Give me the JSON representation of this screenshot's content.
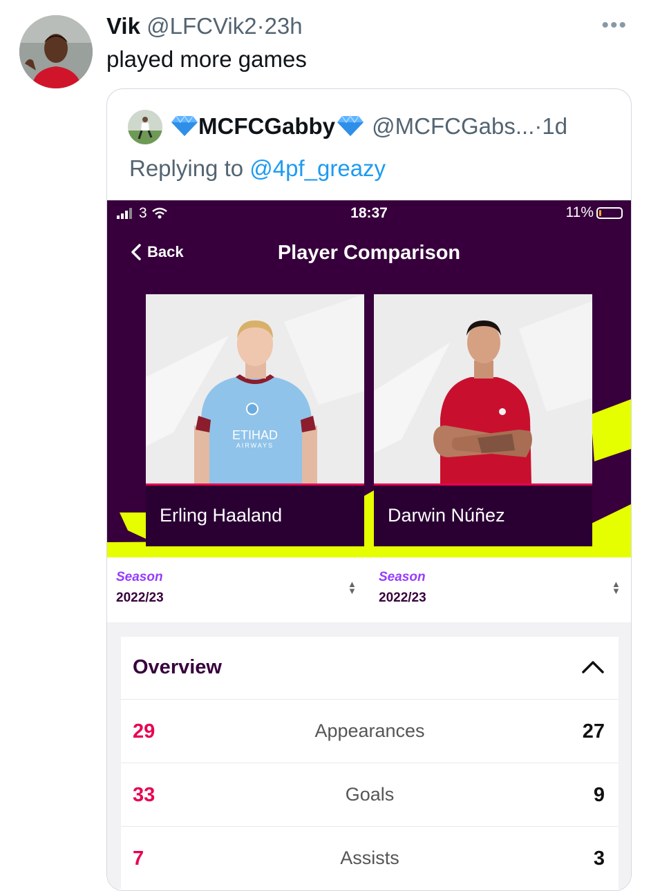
{
  "tweet": {
    "author_name": "Vik",
    "author_handle": "@LFCVik2",
    "separator": "·",
    "age": "23h",
    "more_icon": "ellipsis-icon",
    "text": "played more games"
  },
  "quoted_tweet": {
    "author_name": "MCFCGabby",
    "author_handle": "@MCFCGabs...",
    "separator": "·",
    "age": "1d",
    "replying_prefix": "Replying to",
    "replying_to": "@4pf_greazy",
    "gem_icon": "diamond-icon"
  },
  "app_screenshot": {
    "status_bar": {
      "carrier": "3",
      "time": "18:37",
      "battery": "11%",
      "battery_level": 0.11
    },
    "nav": {
      "back_label": "Back",
      "title": "Player Comparison"
    },
    "players": [
      {
        "name": "Erling Haaland",
        "shirt_sponsor_line1": "ETIHAD",
        "shirt_sponsor_line2": "AIRWAYS"
      },
      {
        "name": "Darwin Núñez"
      }
    ],
    "seasons": [
      {
        "label": "Season",
        "value": "2022/23"
      },
      {
        "label": "Season",
        "value": "2022/23"
      }
    ],
    "overview": {
      "title": "Overview",
      "stats": [
        {
          "left": "29",
          "label": "Appearances",
          "right": "27"
        },
        {
          "left": "33",
          "label": "Goals",
          "right": "9"
        },
        {
          "left": "7",
          "label": "Assists",
          "right": "3"
        }
      ]
    }
  },
  "colors": {
    "pl_purple": "#37003c",
    "pl_pink": "#e90052",
    "pl_lime": "#e6ff00",
    "link_blue": "#1d9bf0",
    "muted_gray": "#536471"
  }
}
